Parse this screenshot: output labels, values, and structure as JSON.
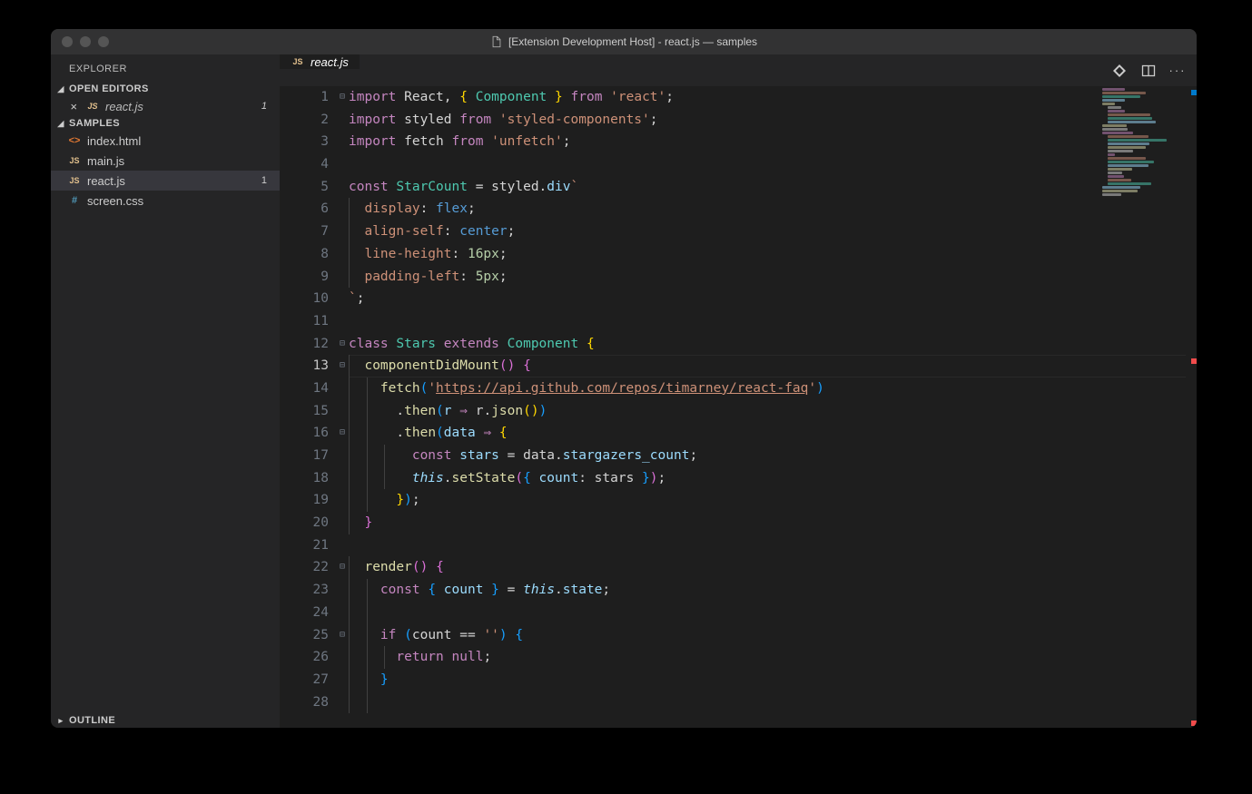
{
  "titlebar": {
    "title": "[Extension Development Host] - react.js — samples"
  },
  "sidebar": {
    "title": "EXPLORER",
    "sections": {
      "open_editors": {
        "label": "OPEN EDITORS",
        "items": [
          {
            "icon": "JS",
            "name": "react.js",
            "badge": "1"
          }
        ]
      },
      "workspace": {
        "label": "SAMPLES",
        "items": [
          {
            "icon_type": "html",
            "icon": "<>",
            "name": "index.html"
          },
          {
            "icon_type": "js",
            "icon": "JS",
            "name": "main.js"
          },
          {
            "icon_type": "js",
            "icon": "JS",
            "name": "react.js",
            "badge": "1",
            "active": true
          },
          {
            "icon_type": "css",
            "icon": "#",
            "name": "screen.css"
          }
        ]
      },
      "outline": {
        "label": "OUTLINE"
      }
    }
  },
  "tabbar": {
    "tabs": [
      {
        "icon": "JS",
        "name": "react.js"
      }
    ]
  },
  "editor": {
    "current_line": 13,
    "lines": [
      {
        "n": 1,
        "fold": "⊟",
        "tokens": [
          [
            "kw",
            "import"
          ],
          [
            "id",
            " React"
          ],
          [
            "punc",
            ", "
          ],
          [
            "brace1",
            "{"
          ],
          [
            "id",
            " "
          ],
          [
            "cl",
            "Component"
          ],
          [
            "id",
            " "
          ],
          [
            "brace1",
            "}"
          ],
          [
            "id",
            " "
          ],
          [
            "kw",
            "from"
          ],
          [
            "id",
            " "
          ],
          [
            "str",
            "'react'"
          ],
          [
            "punc",
            ";"
          ]
        ]
      },
      {
        "n": 2,
        "tokens": [
          [
            "kw",
            "import"
          ],
          [
            "id",
            " styled "
          ],
          [
            "kw",
            "from"
          ],
          [
            "id",
            " "
          ],
          [
            "str",
            "'styled-components'"
          ],
          [
            "punc",
            ";"
          ]
        ]
      },
      {
        "n": 3,
        "tokens": [
          [
            "kw",
            "import"
          ],
          [
            "id",
            " fetch "
          ],
          [
            "kw",
            "from"
          ],
          [
            "id",
            " "
          ],
          [
            "str",
            "'unfetch'"
          ],
          [
            "punc",
            ";"
          ]
        ]
      },
      {
        "n": 4,
        "tokens": []
      },
      {
        "n": 5,
        "tokens": [
          [
            "kw",
            "const"
          ],
          [
            "id",
            " "
          ],
          [
            "cl",
            "StarCount"
          ],
          [
            "id",
            " "
          ],
          [
            "op",
            "="
          ],
          [
            "id",
            " styled"
          ],
          [
            "punc",
            "."
          ],
          [
            "prop",
            "div"
          ],
          [
            "str",
            "`"
          ]
        ]
      },
      {
        "n": 6,
        "indent": 1,
        "tokens": [
          [
            "id",
            "  "
          ],
          [
            "css-prop",
            "display"
          ],
          [
            "punc",
            ":"
          ],
          [
            "id",
            " "
          ],
          [
            "css-kw",
            "flex"
          ],
          [
            "punc",
            ";"
          ]
        ]
      },
      {
        "n": 7,
        "indent": 1,
        "tokens": [
          [
            "id",
            "  "
          ],
          [
            "css-prop",
            "align-self"
          ],
          [
            "punc",
            ":"
          ],
          [
            "id",
            " "
          ],
          [
            "css-kw",
            "center"
          ],
          [
            "punc",
            ";"
          ]
        ]
      },
      {
        "n": 8,
        "indent": 1,
        "tokens": [
          [
            "id",
            "  "
          ],
          [
            "css-prop",
            "line-height"
          ],
          [
            "punc",
            ":"
          ],
          [
            "id",
            " "
          ],
          [
            "num",
            "16px"
          ],
          [
            "punc",
            ";"
          ]
        ]
      },
      {
        "n": 9,
        "indent": 1,
        "tokens": [
          [
            "id",
            "  "
          ],
          [
            "css-prop",
            "padding-left"
          ],
          [
            "punc",
            ":"
          ],
          [
            "id",
            " "
          ],
          [
            "num",
            "5px"
          ],
          [
            "punc",
            ";"
          ]
        ]
      },
      {
        "n": 10,
        "tokens": [
          [
            "str",
            "`"
          ],
          [
            "punc",
            ";"
          ]
        ]
      },
      {
        "n": 11,
        "tokens": []
      },
      {
        "n": 12,
        "fold": "⊟",
        "tokens": [
          [
            "kw",
            "class"
          ],
          [
            "id",
            " "
          ],
          [
            "cl",
            "Stars"
          ],
          [
            "id",
            " "
          ],
          [
            "kw",
            "extends"
          ],
          [
            "id",
            " "
          ],
          [
            "cl",
            "Component"
          ],
          [
            "id",
            " "
          ],
          [
            "brace1",
            "{"
          ]
        ]
      },
      {
        "n": 13,
        "fold": "⊟",
        "current": true,
        "indent": 1,
        "tokens": [
          [
            "id",
            "  "
          ],
          [
            "fn",
            "componentDidMount"
          ],
          [
            "brace2",
            "("
          ],
          [
            "brace2",
            ")"
          ],
          [
            "id",
            " "
          ],
          [
            "brace2",
            "{"
          ]
        ]
      },
      {
        "n": 14,
        "indent": 2,
        "tokens": [
          [
            "id",
            "    "
          ],
          [
            "fn",
            "fetch"
          ],
          [
            "brace3",
            "("
          ],
          [
            "str",
            "'"
          ],
          [
            "str str-und",
            "https://api.github.com/repos/timarney/react-faq"
          ],
          [
            "str",
            "'"
          ],
          [
            "brace3",
            ")"
          ]
        ]
      },
      {
        "n": 15,
        "indent": 2,
        "tokens": [
          [
            "id",
            "      "
          ],
          [
            "punc",
            "."
          ],
          [
            "fn",
            "then"
          ],
          [
            "brace3",
            "("
          ],
          [
            "var",
            "r"
          ],
          [
            "id",
            " "
          ],
          [
            "kw",
            "⇒"
          ],
          [
            "id",
            " r"
          ],
          [
            "punc",
            "."
          ],
          [
            "fn",
            "json"
          ],
          [
            "brace1",
            "("
          ],
          [
            "brace1",
            ")"
          ],
          [
            "brace3",
            ")"
          ]
        ]
      },
      {
        "n": 16,
        "fold": "⊟",
        "indent": 2,
        "tokens": [
          [
            "id",
            "      "
          ],
          [
            "punc",
            "."
          ],
          [
            "fn",
            "then"
          ],
          [
            "brace3",
            "("
          ],
          [
            "var",
            "data"
          ],
          [
            "id",
            " "
          ],
          [
            "kw",
            "⇒"
          ],
          [
            "id",
            " "
          ],
          [
            "brace1",
            "{"
          ]
        ]
      },
      {
        "n": 17,
        "indent": 3,
        "tokens": [
          [
            "id",
            "        "
          ],
          [
            "kw",
            "const"
          ],
          [
            "id",
            " "
          ],
          [
            "var",
            "stars"
          ],
          [
            "id",
            " "
          ],
          [
            "op",
            "="
          ],
          [
            "id",
            " data"
          ],
          [
            "punc",
            "."
          ],
          [
            "prop",
            "stargazers_count"
          ],
          [
            "punc",
            ";"
          ]
        ]
      },
      {
        "n": 18,
        "indent": 3,
        "tokens": [
          [
            "id",
            "        "
          ],
          [
            "var ital",
            "this"
          ],
          [
            "punc",
            "."
          ],
          [
            "fn",
            "setState"
          ],
          [
            "brace2",
            "("
          ],
          [
            "brace3",
            "{"
          ],
          [
            "id",
            " "
          ],
          [
            "prop",
            "count"
          ],
          [
            "punc",
            ":"
          ],
          [
            "id",
            " stars "
          ],
          [
            "brace3",
            "}"
          ],
          [
            "brace2",
            ")"
          ],
          [
            "punc",
            ";"
          ]
        ]
      },
      {
        "n": 19,
        "indent": 2,
        "tokens": [
          [
            "id",
            "      "
          ],
          [
            "brace1",
            "}"
          ],
          [
            "brace3",
            ")"
          ],
          [
            "punc",
            ";"
          ]
        ]
      },
      {
        "n": 20,
        "indent": 1,
        "tokens": [
          [
            "id",
            "  "
          ],
          [
            "brace2",
            "}"
          ]
        ]
      },
      {
        "n": 21,
        "tokens": []
      },
      {
        "n": 22,
        "fold": "⊟",
        "indent": 1,
        "tokens": [
          [
            "id",
            "  "
          ],
          [
            "fn",
            "render"
          ],
          [
            "brace2",
            "("
          ],
          [
            "brace2",
            ")"
          ],
          [
            "id",
            " "
          ],
          [
            "brace2",
            "{"
          ]
        ]
      },
      {
        "n": 23,
        "indent": 2,
        "tokens": [
          [
            "id",
            "    "
          ],
          [
            "kw",
            "const"
          ],
          [
            "id",
            " "
          ],
          [
            "brace3",
            "{"
          ],
          [
            "id",
            " "
          ],
          [
            "var",
            "count"
          ],
          [
            "id",
            " "
          ],
          [
            "brace3",
            "}"
          ],
          [
            "id",
            " "
          ],
          [
            "op",
            "="
          ],
          [
            "id",
            " "
          ],
          [
            "var ital",
            "this"
          ],
          [
            "punc",
            "."
          ],
          [
            "prop",
            "state"
          ],
          [
            "punc",
            ";"
          ]
        ]
      },
      {
        "n": 24,
        "indent": 2,
        "tokens": []
      },
      {
        "n": 25,
        "fold": "⊟",
        "indent": 2,
        "tokens": [
          [
            "id",
            "    "
          ],
          [
            "kw",
            "if"
          ],
          [
            "id",
            " "
          ],
          [
            "brace3",
            "("
          ],
          [
            "id",
            "count "
          ],
          [
            "op",
            "=="
          ],
          [
            "id",
            " "
          ],
          [
            "str",
            "''"
          ],
          [
            "brace3",
            ")"
          ],
          [
            "id",
            " "
          ],
          [
            "brace3",
            "{"
          ]
        ]
      },
      {
        "n": 26,
        "indent": 3,
        "tokens": [
          [
            "id",
            "      "
          ],
          [
            "kw",
            "return"
          ],
          [
            "id",
            " "
          ],
          [
            "kw",
            "null"
          ],
          [
            "punc",
            ";"
          ]
        ]
      },
      {
        "n": 27,
        "indent": 2,
        "tokens": [
          [
            "id",
            "    "
          ],
          [
            "brace3",
            "}"
          ]
        ]
      },
      {
        "n": 28,
        "indent": 2,
        "tokens": []
      }
    ]
  }
}
